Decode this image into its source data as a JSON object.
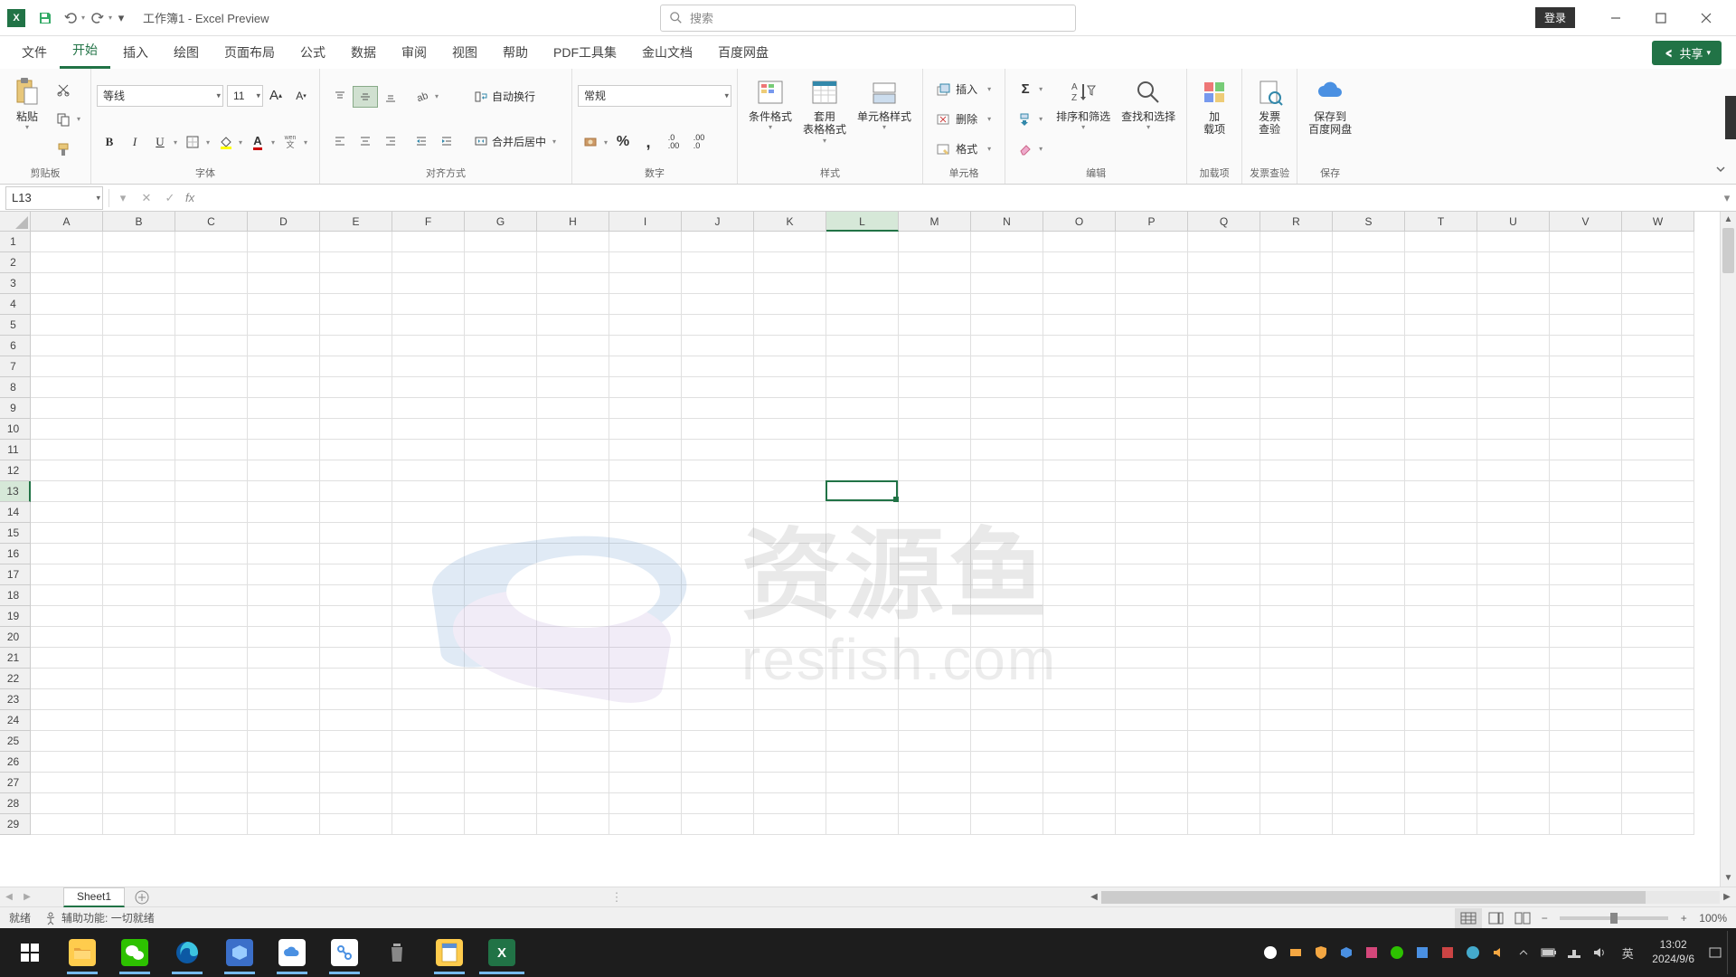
{
  "title": {
    "workbook": "工作簿1",
    "app": "Excel Preview",
    "sep": " - "
  },
  "search": {
    "placeholder": "搜索"
  },
  "login": "登录",
  "tabs": {
    "items": [
      "文件",
      "开始",
      "插入",
      "绘图",
      "页面布局",
      "公式",
      "数据",
      "审阅",
      "视图",
      "帮助",
      "PDF工具集",
      "金山文档",
      "百度网盘"
    ],
    "active": 1,
    "share": "共享"
  },
  "ribbon": {
    "clipboard": {
      "label": "剪贴板",
      "paste": "粘贴"
    },
    "font": {
      "label": "字体",
      "name": "等线",
      "size": "11",
      "bold": "B",
      "italic": "I",
      "underline": "U",
      "wen": "wen\n文"
    },
    "align": {
      "label": "对齐方式",
      "wrap": "自动换行",
      "merge": "合并后居中"
    },
    "number": {
      "label": "数字",
      "format": "常规"
    },
    "styles": {
      "label": "样式",
      "cond": "条件格式",
      "table": "套用\n表格格式",
      "cell": "单元格样式"
    },
    "cells": {
      "label": "单元格",
      "insert": "插入",
      "delete": "删除",
      "format": "格式"
    },
    "editing": {
      "label": "编辑",
      "sort": "排序和筛选",
      "find": "查找和选择"
    },
    "addins": {
      "label": "加载项",
      "btn": "加\n载项"
    },
    "invoice": {
      "label": "发票查验",
      "btn": "发票\n查验"
    },
    "save": {
      "label": "保存",
      "btn": "保存到\n百度网盘"
    }
  },
  "formula": {
    "ref": "L13",
    "fx": "fx"
  },
  "grid": {
    "cols": [
      "A",
      "B",
      "C",
      "D",
      "E",
      "F",
      "G",
      "H",
      "I",
      "J",
      "K",
      "L",
      "M",
      "N",
      "O",
      "P",
      "Q",
      "R",
      "S",
      "T",
      "U",
      "V",
      "W"
    ],
    "rows": 29,
    "active": {
      "col": "L",
      "colIdx": 11,
      "row": 13
    }
  },
  "watermark": {
    "main": "资源鱼",
    "sub": "resfish.com"
  },
  "sheets": {
    "name": "Sheet1"
  },
  "status": {
    "ready": "就绪",
    "a11y_label": "辅助功能:",
    "a11y_val": "一切就绪",
    "zoom": "100%"
  },
  "taskbar": {
    "ime": "英",
    "time": "13:02",
    "date": "2024/9/6"
  }
}
